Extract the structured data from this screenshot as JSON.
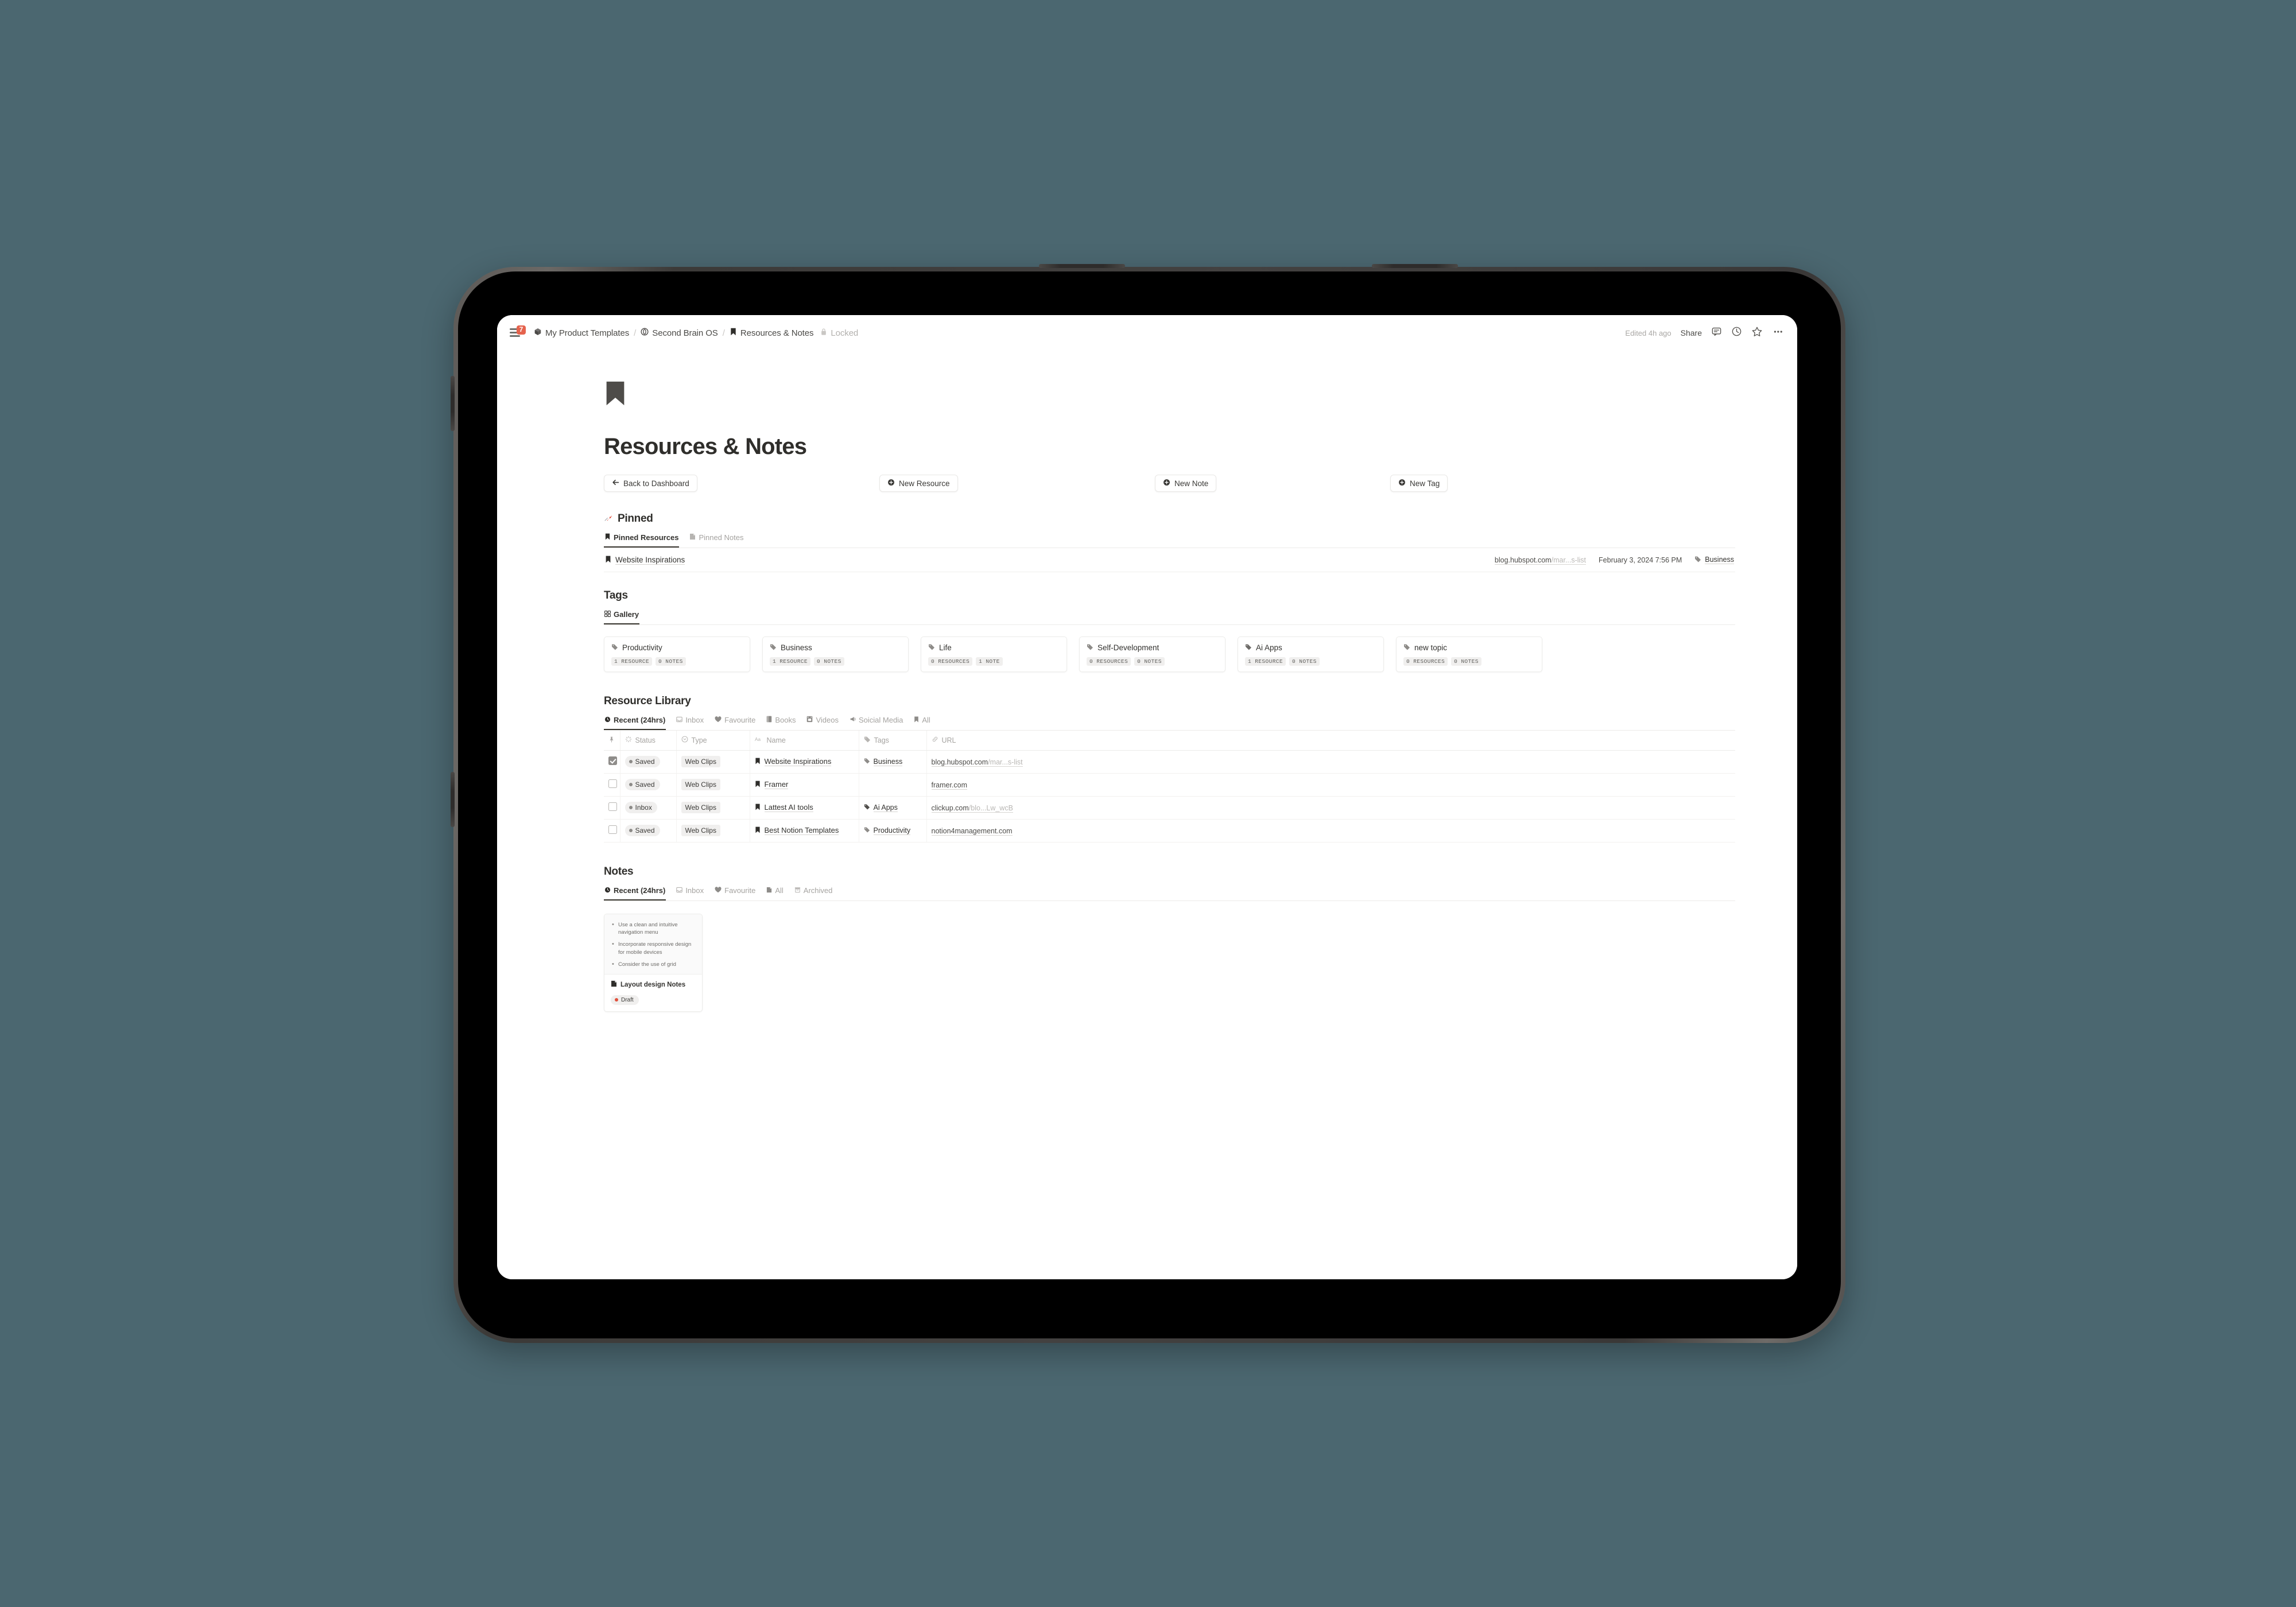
{
  "topbar": {
    "notification_count": "7",
    "breadcrumb": [
      {
        "icon": "package-icon",
        "label": "My Product Templates"
      },
      {
        "icon": "circle-o-icon",
        "label": "Second Brain OS"
      },
      {
        "icon": "bookmark-icon",
        "label": "Resources & Notes"
      }
    ],
    "separator": "/",
    "locked_label": "Locked",
    "edited_label": "Edited 4h ago",
    "share_label": "Share"
  },
  "page": {
    "icon": "bookmark-icon",
    "title": "Resources & Notes"
  },
  "actions": {
    "back": "Back to Dashboard",
    "new_resource": "New Resource",
    "new_note": "New Note",
    "new_tag": "New Tag"
  },
  "pinned": {
    "heading": "Pinned",
    "heading_icon": "pushpin-icon",
    "tabs": [
      {
        "label": "Pinned Resources",
        "icon": "bookmark-icon",
        "active": true
      },
      {
        "label": "Pinned Notes",
        "icon": "note-icon",
        "active": false
      }
    ],
    "row": {
      "name": "Website Inspirations",
      "url_main": "blog.hubspot.com",
      "url_path": "/mar...s-list",
      "date": "February 3, 2024 7:56 PM",
      "tag": "Business"
    }
  },
  "tags": {
    "heading": "Tags",
    "tabs": [
      {
        "label": "Gallery",
        "icon": "gallery-icon",
        "active": true
      }
    ],
    "cards": [
      {
        "name": "Productivity",
        "resources": "1 RESOURCE",
        "notes": "0 NOTES"
      },
      {
        "name": "Business",
        "resources": "1 RESOURCE",
        "notes": "0 NOTES"
      },
      {
        "name": "Life",
        "resources": "0 RESOURCES",
        "notes": "1 NOTE"
      },
      {
        "name": "Self-Development",
        "resources": "0 RESOURCES",
        "notes": "0 NOTES"
      },
      {
        "name": "Ai Apps",
        "resources": "1 RESOURCE",
        "notes": "0 NOTES"
      },
      {
        "name": "new topic",
        "resources": "0 RESOURCES",
        "notes": "0 NOTES"
      }
    ]
  },
  "resource_library": {
    "heading": "Resource Library",
    "tabs": [
      {
        "label": "Recent (24hrs)",
        "icon": "clock-icon",
        "active": true
      },
      {
        "label": "Inbox",
        "icon": "inbox-icon",
        "active": false
      },
      {
        "label": "Favourite",
        "icon": "heart-icon",
        "active": false
      },
      {
        "label": "Books",
        "icon": "book-icon",
        "active": false
      },
      {
        "label": "Videos",
        "icon": "video-icon",
        "active": false
      },
      {
        "label": "Soicial Media",
        "icon": "megaphone-icon",
        "active": false
      },
      {
        "label": "All",
        "icon": "bookmark-icon",
        "active": false
      }
    ],
    "columns": [
      {
        "label": "",
        "icon": "pin-icon"
      },
      {
        "label": "Status",
        "icon": "status-icon"
      },
      {
        "label": "Type",
        "icon": "select-icon"
      },
      {
        "label": "Name",
        "icon": "aa-icon"
      },
      {
        "label": "Tags",
        "icon": "tag-icon"
      },
      {
        "label": "URL",
        "icon": "link-icon"
      }
    ],
    "rows": [
      {
        "checked": true,
        "status": "Saved",
        "type": "Web Clips",
        "name": "Website Inspirations",
        "tag": "Business",
        "url_main": "blog.hubspot.com",
        "url_path": "/mar...s-list"
      },
      {
        "checked": false,
        "status": "Saved",
        "type": "Web Clips",
        "name": "Framer",
        "tag": "",
        "url_main": "framer.com",
        "url_path": ""
      },
      {
        "checked": false,
        "status": "Inbox",
        "type": "Web Clips",
        "name": "Lattest AI tools",
        "tag": "Ai Apps",
        "url_main": "clickup.com",
        "url_path": "/blo...Lw_wcB"
      },
      {
        "checked": false,
        "status": "Saved",
        "type": "Web Clips",
        "name": "Best Notion Templates",
        "tag": "Productivity",
        "url_main": "notion4management.com",
        "url_path": ""
      }
    ]
  },
  "notes": {
    "heading": "Notes",
    "tabs": [
      {
        "label": "Recent (24hrs)",
        "icon": "clock-icon",
        "active": true
      },
      {
        "label": "Inbox",
        "icon": "inbox-icon",
        "active": false
      },
      {
        "label": "Favourite",
        "icon": "heart-icon",
        "active": false
      },
      {
        "label": "All",
        "icon": "note-icon",
        "active": false
      },
      {
        "label": "Archived",
        "icon": "archive-icon",
        "active": false
      }
    ],
    "card": {
      "bullets": [
        "Use a clean and intuitive navigation menu",
        "Incorporate responsive design for mobile devices",
        "Consider the use of grid"
      ],
      "title": "Layout design Notes",
      "status": "Draft",
      "status_color": "#e0503c"
    }
  }
}
